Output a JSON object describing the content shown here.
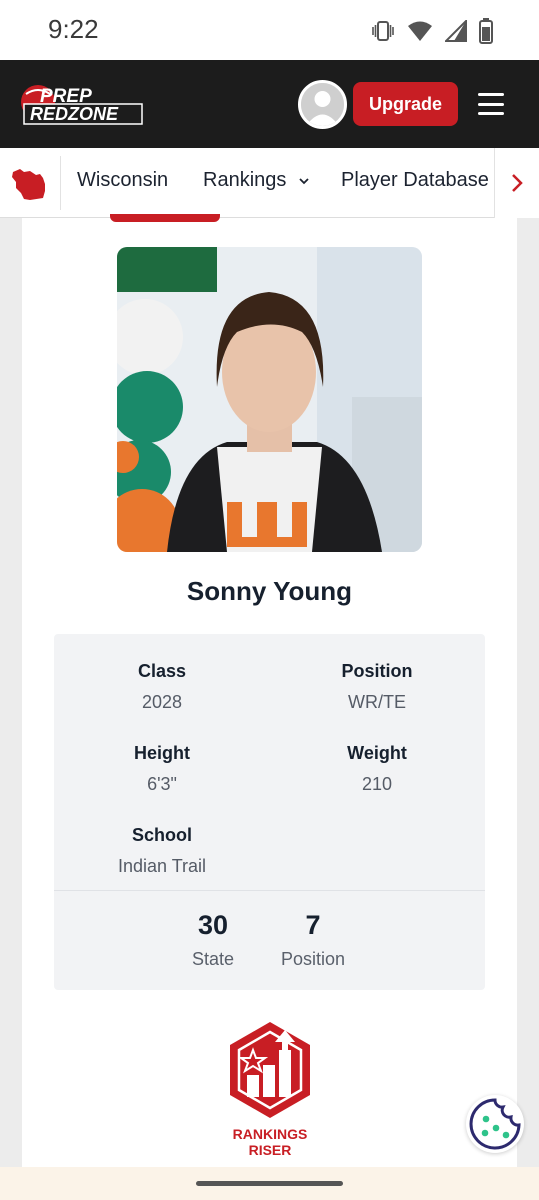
{
  "status_bar": {
    "time": "9:22"
  },
  "header": {
    "logo_top": "PREP",
    "logo_bottom": "REDZONE",
    "upgrade_label": "Upgrade",
    "accent_color": "#c81e24"
  },
  "subnav": {
    "items": [
      {
        "label": "Wisconsin"
      },
      {
        "label": "Rankings",
        "has_dropdown": true
      },
      {
        "label": "Player Database"
      }
    ]
  },
  "player": {
    "name": "Sonny Young",
    "details": {
      "class_label": "Class",
      "class_value": "2028",
      "position_label": "Position",
      "position_value": "WR/TE",
      "height_label": "Height",
      "height_value": "6'3\"",
      "weight_label": "Weight",
      "weight_value": "210",
      "school_label": "School",
      "school_value": "Indian Trail"
    },
    "rankings": {
      "state_rank": "30",
      "state_label": "State",
      "position_rank": "7",
      "position_label": "Position"
    }
  },
  "badge": {
    "line1": "RANKINGS",
    "line2": "RISER"
  }
}
